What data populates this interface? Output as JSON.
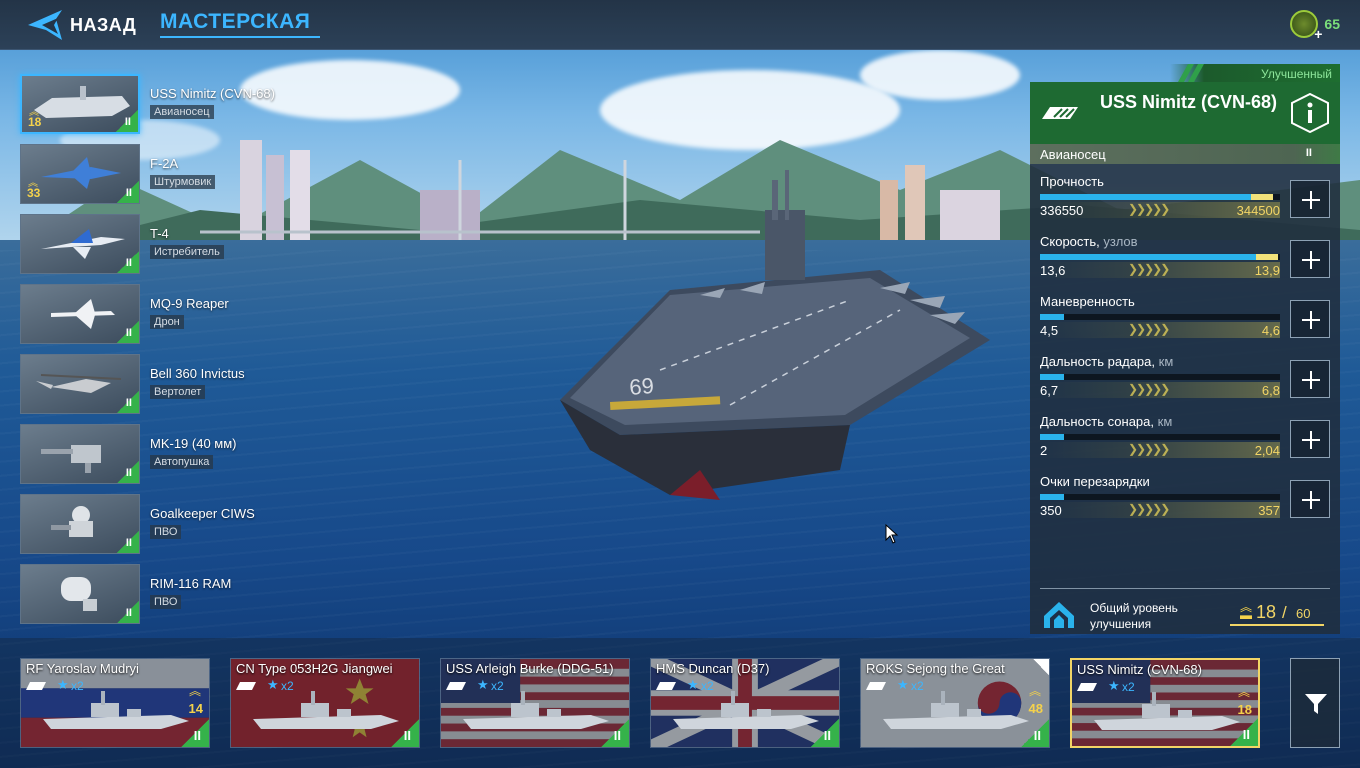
{
  "topbar": {
    "back_label": "НАЗАД",
    "title": "МАСТЕРСКАЯ",
    "currency_value": "65"
  },
  "weapons": [
    {
      "name": "USS Nimitz (CVN-68)",
      "type": "Авианосец",
      "level": "18",
      "tier": "II",
      "icon": "carrier-icon",
      "active": true
    },
    {
      "name": "F-2A",
      "type": "Штурмовик",
      "level": "33",
      "tier": "II",
      "icon": "attack-jet-icon"
    },
    {
      "name": "T-4",
      "type": "Истребитель",
      "level": "",
      "tier": "II",
      "icon": "fighter-jet-icon"
    },
    {
      "name": "MQ-9 Reaper",
      "type": "Дрон",
      "level": "",
      "tier": "II",
      "icon": "drone-icon"
    },
    {
      "name": "Bell 360 Invictus",
      "type": "Вертолет",
      "level": "",
      "tier": "II",
      "icon": "helicopter-icon"
    },
    {
      "name": "MK-19 (40 мм)",
      "type": "Автопушка",
      "level": "",
      "tier": "II",
      "icon": "autocannon-icon"
    },
    {
      "name": "Goalkeeper CIWS",
      "type": "ПВО",
      "level": "",
      "tier": "II",
      "icon": "ciws-icon"
    },
    {
      "name": "RIM-116 RAM",
      "type": "ПВО",
      "level": "",
      "tier": "II",
      "icon": "missile-launcher-icon"
    }
  ],
  "panel": {
    "upgraded_label": "Улучшенный",
    "ship_name": "USS Nimitz (CVN-68)",
    "class_label": "Авианосец",
    "tier": "II",
    "stats": [
      {
        "label": "Прочность",
        "unit": "",
        "current": "336550",
        "upgraded": "344500",
        "fill": 0.88,
        "gain": 0.09
      },
      {
        "label": "Скорость,",
        "unit": "узлов",
        "current": "13,6",
        "upgraded": "13,9",
        "fill": 0.9,
        "gain": 0.09
      },
      {
        "label": "Маневренность",
        "unit": "",
        "current": "4,5",
        "upgraded": "4,6",
        "fill": 0.1,
        "gain": 0.0
      },
      {
        "label": "Дальность радара,",
        "unit": "км",
        "current": "6,7",
        "upgraded": "6,8",
        "fill": 0.1,
        "gain": 0.0
      },
      {
        "label": "Дальность сонара,",
        "unit": "км",
        "current": "2",
        "upgraded": "2,04",
        "fill": 0.1,
        "gain": 0.0
      },
      {
        "label": "Очки перезарядки",
        "unit": "",
        "current": "350",
        "upgraded": "357",
        "fill": 0.1,
        "gain": 0.0
      }
    ],
    "upgrade_label": "Общий уровень улучшения",
    "upgrade_current": "18",
    "upgrade_max": "60"
  },
  "ships": [
    {
      "name": "RF Yaroslav Mudryi",
      "mult": "x2",
      "level": "14",
      "tier": "II",
      "flag": "russia"
    },
    {
      "name": "CN Type 053H2G Jiangwei",
      "mult": "x2",
      "level": "",
      "tier": "II",
      "flag": "china"
    },
    {
      "name": "USS Arleigh Burke (DDG-51)",
      "mult": "x2",
      "level": "",
      "tier": "II",
      "flag": "usa"
    },
    {
      "name": "HMS Duncan (D37)",
      "mult": "x2",
      "level": "",
      "tier": "II",
      "flag": "uk"
    },
    {
      "name": "ROKS Sejong the Great",
      "mult": "x2",
      "level": "48",
      "tier": "II",
      "flag": "korea"
    },
    {
      "name": "USS Nimitz (CVN-68)",
      "mult": "x2",
      "level": "18",
      "tier": "II",
      "flag": "usa",
      "active": true
    }
  ],
  "colors": {
    "accent": "#3cb6ff",
    "tier_green": "#35b24a",
    "upgrade_gold": "#f2d566",
    "header_green": "#1e6a32"
  }
}
